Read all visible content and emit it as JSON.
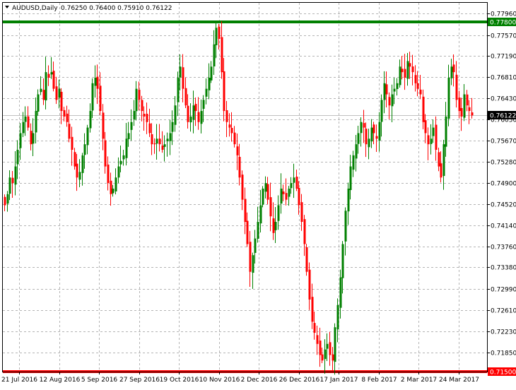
{
  "header": {
    "symbol": "AUDUSD,Daily",
    "ohlc": "0.76250 0.76400 0.75910 0.76122"
  },
  "colors": {
    "background": "#ffffff",
    "grid": "#b4b4b4",
    "bull": "#008000",
    "bear": "#ff0000",
    "resistance_line": "#008000",
    "support_line": "#ff0000",
    "price_line": "#c0c0c0",
    "current_price_box": "#000000"
  },
  "chart_data": {
    "type": "candlestick",
    "symbol": "AUDUSD",
    "timeframe": "Daily",
    "y_ticks": [
      "0.77960",
      "0.77570",
      "0.77190",
      "0.76810",
      "0.76430",
      "0.76050",
      "0.75670",
      "0.75280",
      "0.74900",
      "0.74520",
      "0.74140",
      "0.73760",
      "0.73380",
      "0.72990",
      "0.72610",
      "0.72230",
      "0.71850"
    ],
    "x_ticks": [
      "21 Jul 2016",
      "12 Aug 2016",
      "5 Sep 2016",
      "27 Sep 2016",
      "19 Oct 2016",
      "10 Nov 2016",
      "2 Dec 2016",
      "26 Dec 2016",
      "17 Jan 2017",
      "8 Feb 2017",
      "2 Mar 2017",
      "24 Mar 2017"
    ],
    "ylim": [
      0.715,
      0.7815
    ],
    "grid": true,
    "levels": [
      {
        "label": "0.77800",
        "value": 0.778,
        "color": "#008000"
      },
      {
        "label": "0.71500",
        "value": 0.715,
        "color": "#ff0000"
      }
    ],
    "current_price": {
      "label": "0.76122",
      "value": 0.76122
    },
    "closes": [
      0.745,
      0.747,
      0.75,
      0.749,
      0.752,
      0.755,
      0.758,
      0.76,
      0.761,
      0.759,
      0.756,
      0.758,
      0.762,
      0.765,
      0.766,
      0.764,
      0.769,
      0.768,
      0.769,
      0.766,
      0.764,
      0.766,
      0.762,
      0.761,
      0.76,
      0.757,
      0.755,
      0.752,
      0.75,
      0.751,
      0.754,
      0.756,
      0.759,
      0.762,
      0.767,
      0.768,
      0.766,
      0.762,
      0.757,
      0.752,
      0.749,
      0.747,
      0.748,
      0.75,
      0.752,
      0.753,
      0.754,
      0.757,
      0.758,
      0.76,
      0.762,
      0.766,
      0.764,
      0.762,
      0.761,
      0.76,
      0.758,
      0.756,
      0.756,
      0.757,
      0.756,
      0.755,
      0.756,
      0.757,
      0.758,
      0.76,
      0.763,
      0.768,
      0.77,
      0.766,
      0.763,
      0.76,
      0.761,
      0.763,
      0.762,
      0.76,
      0.762,
      0.764,
      0.766,
      0.768,
      0.77,
      0.774,
      0.777,
      0.775,
      0.769,
      0.762,
      0.76,
      0.759,
      0.758,
      0.756,
      0.754,
      0.75,
      0.746,
      0.742,
      0.738,
      0.733,
      0.736,
      0.739,
      0.742,
      0.745,
      0.748,
      0.749,
      0.746,
      0.743,
      0.74,
      0.742,
      0.745,
      0.748,
      0.747,
      0.746,
      0.748,
      0.749,
      0.75,
      0.748,
      0.745,
      0.742,
      0.738,
      0.733,
      0.728,
      0.724,
      0.722,
      0.72,
      0.718,
      0.717,
      0.719,
      0.72,
      0.718,
      0.717,
      0.723,
      0.727,
      0.732,
      0.738,
      0.744,
      0.748,
      0.752,
      0.754,
      0.756,
      0.758,
      0.76,
      0.759,
      0.756,
      0.757,
      0.759,
      0.758,
      0.757,
      0.76,
      0.764,
      0.767,
      0.765,
      0.763,
      0.765,
      0.766,
      0.767,
      0.77,
      0.769,
      0.768,
      0.771,
      0.77,
      0.769,
      0.767,
      0.766,
      0.765,
      0.76,
      0.758,
      0.756,
      0.757,
      0.759,
      0.755,
      0.752,
      0.75,
      0.756,
      0.761,
      0.768,
      0.77,
      0.769,
      0.764,
      0.762,
      0.761,
      0.765,
      0.763,
      0.762,
      0.7612
    ]
  }
}
